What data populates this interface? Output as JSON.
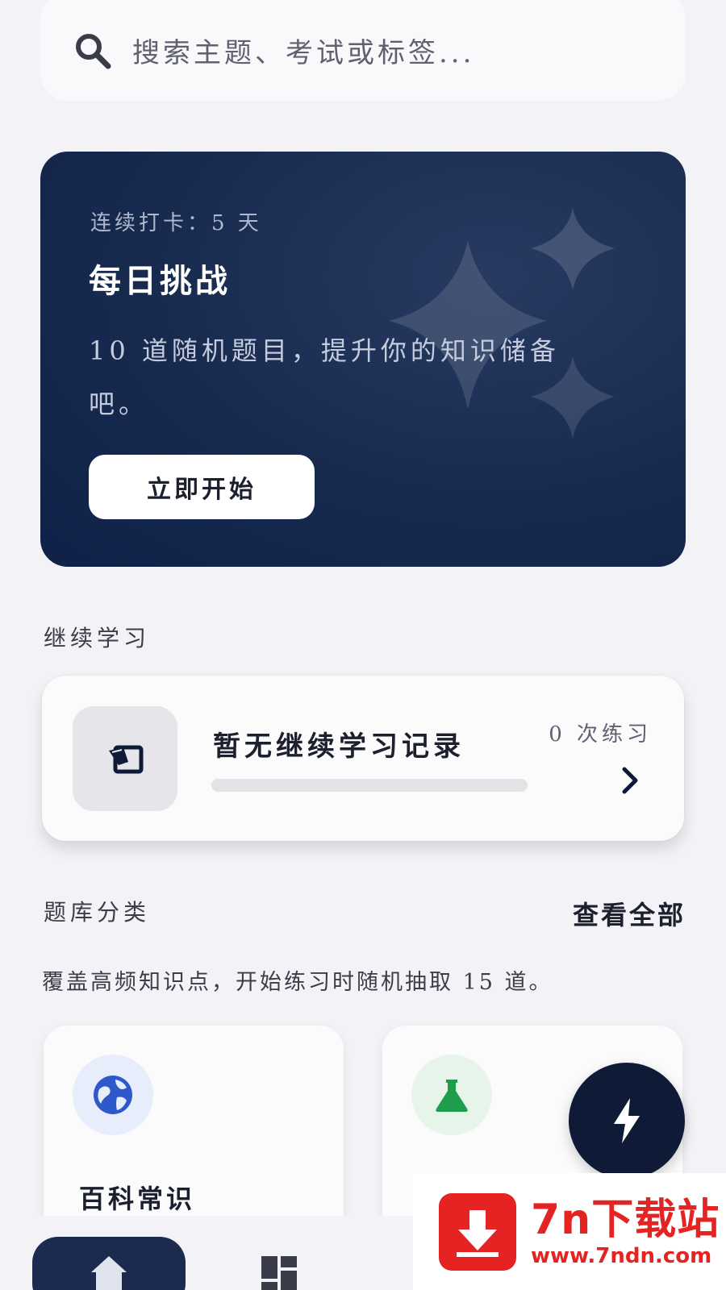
{
  "search": {
    "placeholder": "搜索主题、考试或标签..."
  },
  "daily_challenge": {
    "streak": "连续打卡：5 天",
    "title": "每日挑战",
    "description": "10 道随机题目，提升你的知识储备吧。",
    "start_label": "立即开始"
  },
  "continue_learning": {
    "section_title": "继续学习",
    "record_title": "暂无继续学习记录",
    "practice_count": "0 次练习",
    "progress": 0
  },
  "categories": {
    "section_title": "题库分类",
    "view_all_label": "查看全部",
    "description": "覆盖高频知识点，开始练习时随机抽取 15 道。",
    "items": [
      {
        "name": "百科常识",
        "icon": "globe-icon",
        "color": "#2e59c9"
      },
      {
        "name": "",
        "icon": "flask-icon",
        "color": "#1e9e4a"
      }
    ]
  },
  "fab": {
    "icon": "lightning-icon"
  },
  "bottom_nav": {
    "items": [
      {
        "icon": "home-icon",
        "active": true
      },
      {
        "icon": "categories-icon",
        "active": false
      }
    ]
  },
  "watermark": {
    "title": "7n下载站",
    "url": "www.7ndn.com"
  },
  "colors": {
    "background": "#f3f2f6",
    "challenge_card": "#172a4e",
    "accent_dark": "#0e1a36",
    "watermark_red": "#e52322"
  }
}
